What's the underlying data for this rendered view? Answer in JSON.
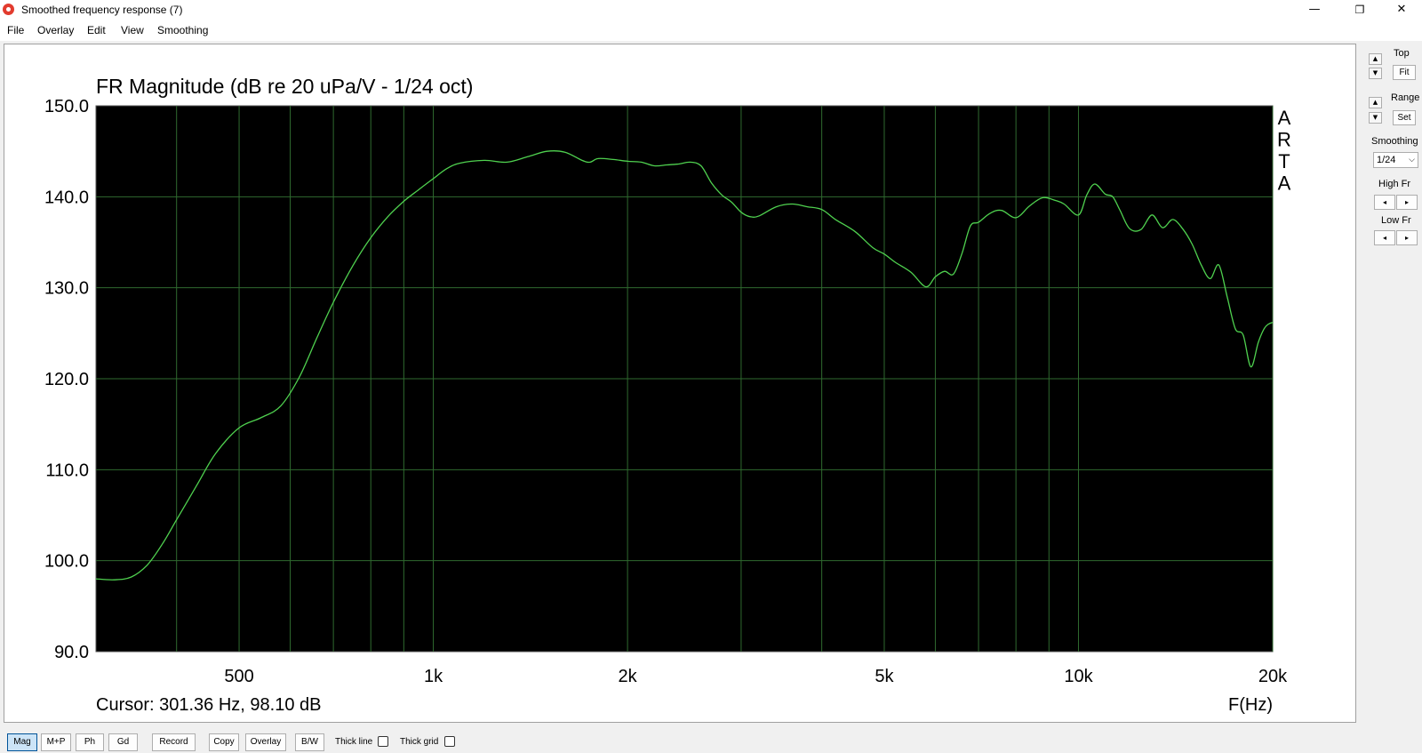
{
  "window": {
    "title": "Smoothed frequency response (7)",
    "minimize_glyph": "—",
    "maximize_glyph": "❐",
    "close_glyph": "✕",
    "icon": "arta-app-icon"
  },
  "menu": {
    "items": [
      "File",
      "Overlay",
      "Edit",
      "View",
      "Smoothing"
    ]
  },
  "chart_data": {
    "type": "line",
    "title": "FR Magnitude (dB re 20 uPa/V - 1/24 oct)",
    "xlabel": "F(Hz)",
    "ylabel": "",
    "x_scale": "log",
    "xlim": [
      300,
      20000
    ],
    "ylim": [
      90,
      150
    ],
    "y_ticks": [
      90,
      100,
      110,
      120,
      130,
      140,
      150
    ],
    "y_tick_labels": [
      "90.0",
      "100.0",
      "110.0",
      "120.0",
      "130.0",
      "140.0",
      "150.0"
    ],
    "x_ticks": [
      500,
      1000,
      2000,
      5000,
      10000,
      20000
    ],
    "x_tick_labels": [
      "500",
      "1k",
      "2k",
      "5k",
      "10k",
      "20k"
    ],
    "grid": true,
    "watermark": "ARTA",
    "background": "#000000",
    "grid_color": "#2f6a2f",
    "line_color": "#4fd14f",
    "series": [
      {
        "x": [
          300,
          320,
          340,
          360,
          380,
          400,
          430,
          460,
          500,
          540,
          580,
          620,
          660,
          700,
          750,
          800,
          850,
          900,
          950,
          1000,
          1050,
          1100,
          1200,
          1300,
          1400,
          1500,
          1600,
          1700,
          1750,
          1800,
          1900,
          2000,
          2100,
          2200,
          2300,
          2400,
          2500,
          2600,
          2700,
          2800,
          2900,
          3000,
          3100,
          3200,
          3400,
          3600,
          3800,
          4000,
          4200,
          4500,
          4800,
          5000,
          5200,
          5500,
          5800,
          6000,
          6200,
          6400,
          6600,
          6800,
          7000,
          7300,
          7600,
          8000,
          8400,
          8800,
          9200,
          9500,
          10000,
          10300,
          10600,
          11000,
          11300,
          11600,
          12000,
          12500,
          13000,
          13500,
          14000,
          14500,
          15000,
          15500,
          16000,
          16500,
          17000,
          17500,
          18000,
          18500,
          19000,
          19400,
          19700,
          20000
        ],
        "y": [
          98.0,
          97.9,
          98.2,
          99.5,
          101.8,
          104.5,
          108.3,
          111.8,
          114.6,
          115.7,
          117.0,
          120.2,
          124.5,
          128.4,
          132.4,
          135.5,
          137.8,
          139.5,
          140.8,
          142.0,
          143.1,
          143.7,
          144.0,
          143.8,
          144.4,
          145.0,
          144.9,
          144.0,
          143.8,
          144.2,
          144.1,
          143.9,
          143.8,
          143.4,
          143.5,
          143.6,
          143.8,
          143.4,
          141.5,
          140.2,
          139.4,
          138.3,
          137.8,
          137.9,
          138.9,
          139.2,
          138.9,
          138.6,
          137.5,
          136.2,
          134.4,
          133.7,
          132.8,
          131.7,
          130.1,
          131.2,
          131.8,
          131.5,
          133.8,
          136.8,
          137.2,
          138.2,
          138.5,
          137.7,
          139.0,
          139.9,
          139.6,
          139.2,
          138.0,
          140.2,
          141.4,
          140.3,
          140.0,
          138.5,
          136.5,
          136.4,
          138.0,
          136.6,
          137.5,
          136.5,
          134.8,
          132.5,
          131.0,
          132.5,
          129.0,
          125.5,
          124.8,
          121.3,
          124.0,
          125.5,
          126.0,
          126.2
        ]
      }
    ],
    "cursor_readout": "Cursor: 301.36 Hz, 98.10 dB"
  },
  "side": {
    "up_glyph": "▲",
    "down_glyph": "▼",
    "top_label": "Top",
    "fit_label": "Fit",
    "range_label": "Range",
    "set_label": "Set",
    "smoothing_label": "Smoothing",
    "smoothing_value": "1/24",
    "caret_glyph": "⌵",
    "high_fr_label": "High Fr",
    "low_fr_label": "Low Fr",
    "left_glyph": "◂",
    "right_glyph": "▸"
  },
  "toolbar": {
    "buttons": [
      "Mag",
      "M+P",
      "Ph",
      "Gd",
      "Record",
      "Copy",
      "Overlay",
      "B/W"
    ],
    "active": "Mag",
    "thick_line_label": "Thick line",
    "thick_grid_label": "Thick grid",
    "thick_line_checked": false,
    "thick_grid_checked": false
  }
}
